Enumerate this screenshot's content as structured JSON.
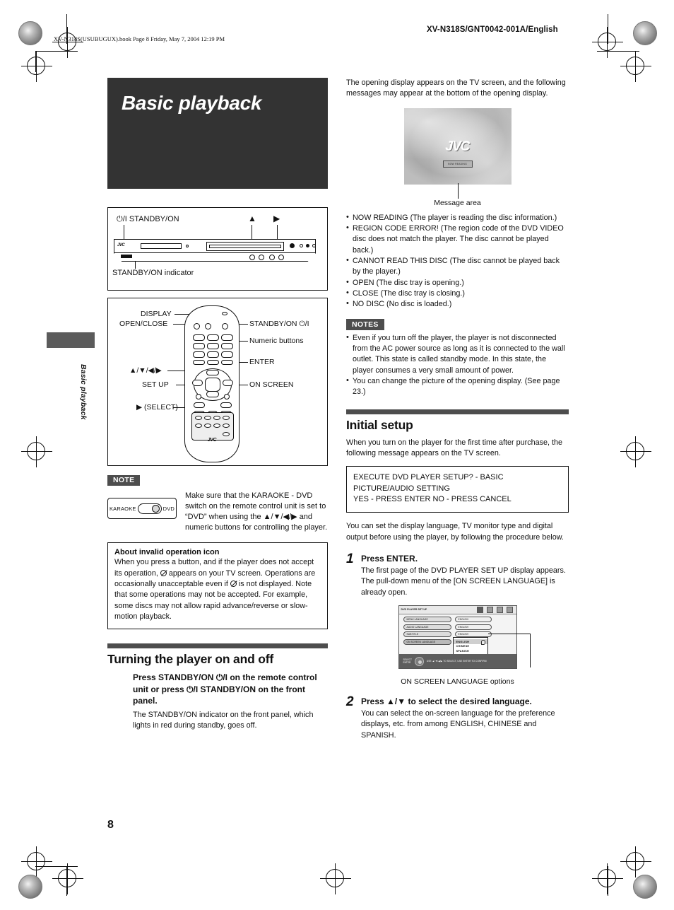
{
  "header": {
    "document_id": "XV-N318S/GNT0042-001A/English",
    "book_line": "XV-N318S(USUBUGUX).book  Page 8  Friday, May 7, 2004  12:19 PM"
  },
  "page_number": "8",
  "side_tab": {
    "label": "Basic playback"
  },
  "chapter": {
    "title": "Basic playback"
  },
  "front_panel_figure": {
    "power_label": "STANDBY/ON",
    "power_symbol": "⏻/I",
    "indicator_label": "STANDBY/ON indicator",
    "eject_symbol": "▲",
    "play_symbol": "▶",
    "brand": "JVC"
  },
  "remote_figure": {
    "labels_left": [
      "DISPLAY",
      "OPEN/CLOSE",
      "▲/▼/◀/▶",
      "SET UP",
      "▶ (SELECT)"
    ],
    "labels_right": [
      "STANDBY/ON ⏻/I",
      "Numeric buttons",
      "ENTER",
      "ON SCREEN"
    ],
    "brand": "JVC"
  },
  "note_karaoke": {
    "tag": "NOTE",
    "switch_left": "KARAOKE",
    "switch_right": "DVD",
    "text": "Make sure that the KARAOKE - DVD switch on the remote control unit is set to “DVD” when using the ▲/▼/◀/▶ and numeric buttons for controlling the player."
  },
  "invalid_icon_box": {
    "heading": "About invalid operation icon",
    "part1": "When you press a button, and if the player does not accept its operation,",
    "part2": "appears on your TV screen. Operations are occasionally unacceptable even if",
    "part3": "is not displayed.",
    "part4": "Note that some operations may not be accepted. For example, some discs may not allow rapid advance/reverse or slow-motion playback."
  },
  "turning_section": {
    "title": "Turning the player on and off",
    "lead_part1": "Press STANDBY/ON",
    "lead_symbol": "⏻/I",
    "lead_part2": "on the remote control unit or press",
    "lead_part3": "STANDBY/ON on the front panel.",
    "body": "The STANDBY/ON indicator on the front panel, which lights in red during standby, goes off."
  },
  "opening_display": {
    "intro": "The opening display appears on the TV screen, and the following messages may appear at the bottom of the opening display.",
    "tv_logo": "JVC",
    "tv_message": "NOW READING",
    "caption": "Message area",
    "messages": [
      "NOW READING (The player is reading the disc information.)",
      "REGION CODE ERROR! (The region code of the DVD VIDEO disc does not match the player. The disc cannot be played back.)",
      "CANNOT READ THIS DISC (The disc cannot be played back by the player.)",
      "OPEN (The disc tray is opening.)",
      "CLOSE (The disc tray is closing.)",
      "NO DISC (No disc is loaded.)"
    ]
  },
  "notes_block": {
    "tag": "NOTES",
    "items": [
      "Even if you turn off the player, the player is not disconnected from the AC power source as long as it is connected to the wall outlet. This state is called standby mode. In this state, the player consumes a very small amount of power.",
      "You can change the picture of the opening display. (See page 23.)"
    ]
  },
  "initial_setup": {
    "title": "Initial setup",
    "intro": "When you turn on the player for the first time after purchase, the following message appears on the TV screen.",
    "osd_line1": "EXECUTE DVD PLAYER SETUP? - BASIC PICTURE/AUDIO SETTING",
    "osd_line2": "YES - PRESS ENTER    NO - PRESS CANCEL",
    "after_osd": "You can set the display language, TV monitor type and digital output before using the player, by following the procedure below.",
    "steps": [
      {
        "num": "1",
        "head": "Press ENTER.",
        "text": "The first page of the DVD PLAYER SET UP display appears. The pull-down menu of the [ON SCREEN LANGUAGE] is already open."
      },
      {
        "num": "2",
        "head": "Press ▲/▼ to select the desired language.",
        "text": "You can select the on-screen language for the preference displays, etc. from among ENGLISH, CHINESE and SPANISH."
      }
    ],
    "setup_screen": {
      "title": "DVD PLAYER SET UP",
      "rows": [
        {
          "label": "MENU LANGUAGE",
          "value": "ENGLISH"
        },
        {
          "label": "AUDIO LANGUAGE",
          "value": "ENGLISH"
        },
        {
          "label": "SUBTITLE",
          "value": "ENGLISH"
        },
        {
          "label": "ON SCREEN LANGUAGE",
          "value": ""
        }
      ],
      "dropdown_options": [
        "ENGLISH",
        "CHINESE",
        "SPANISH"
      ],
      "selected_option": "ENGLISH",
      "bottom_left": "SELECT\nENTER",
      "bottom_right": "USE ▲/▼/◀/▶ TO SELECT, USE ENTER TO CONFIRM"
    },
    "setup_caption": "ON SCREEN LANGUAGE options"
  },
  "colors": {
    "banner": "#333333",
    "rule": "#4d4d4d",
    "tag": "#4d4d4d"
  }
}
